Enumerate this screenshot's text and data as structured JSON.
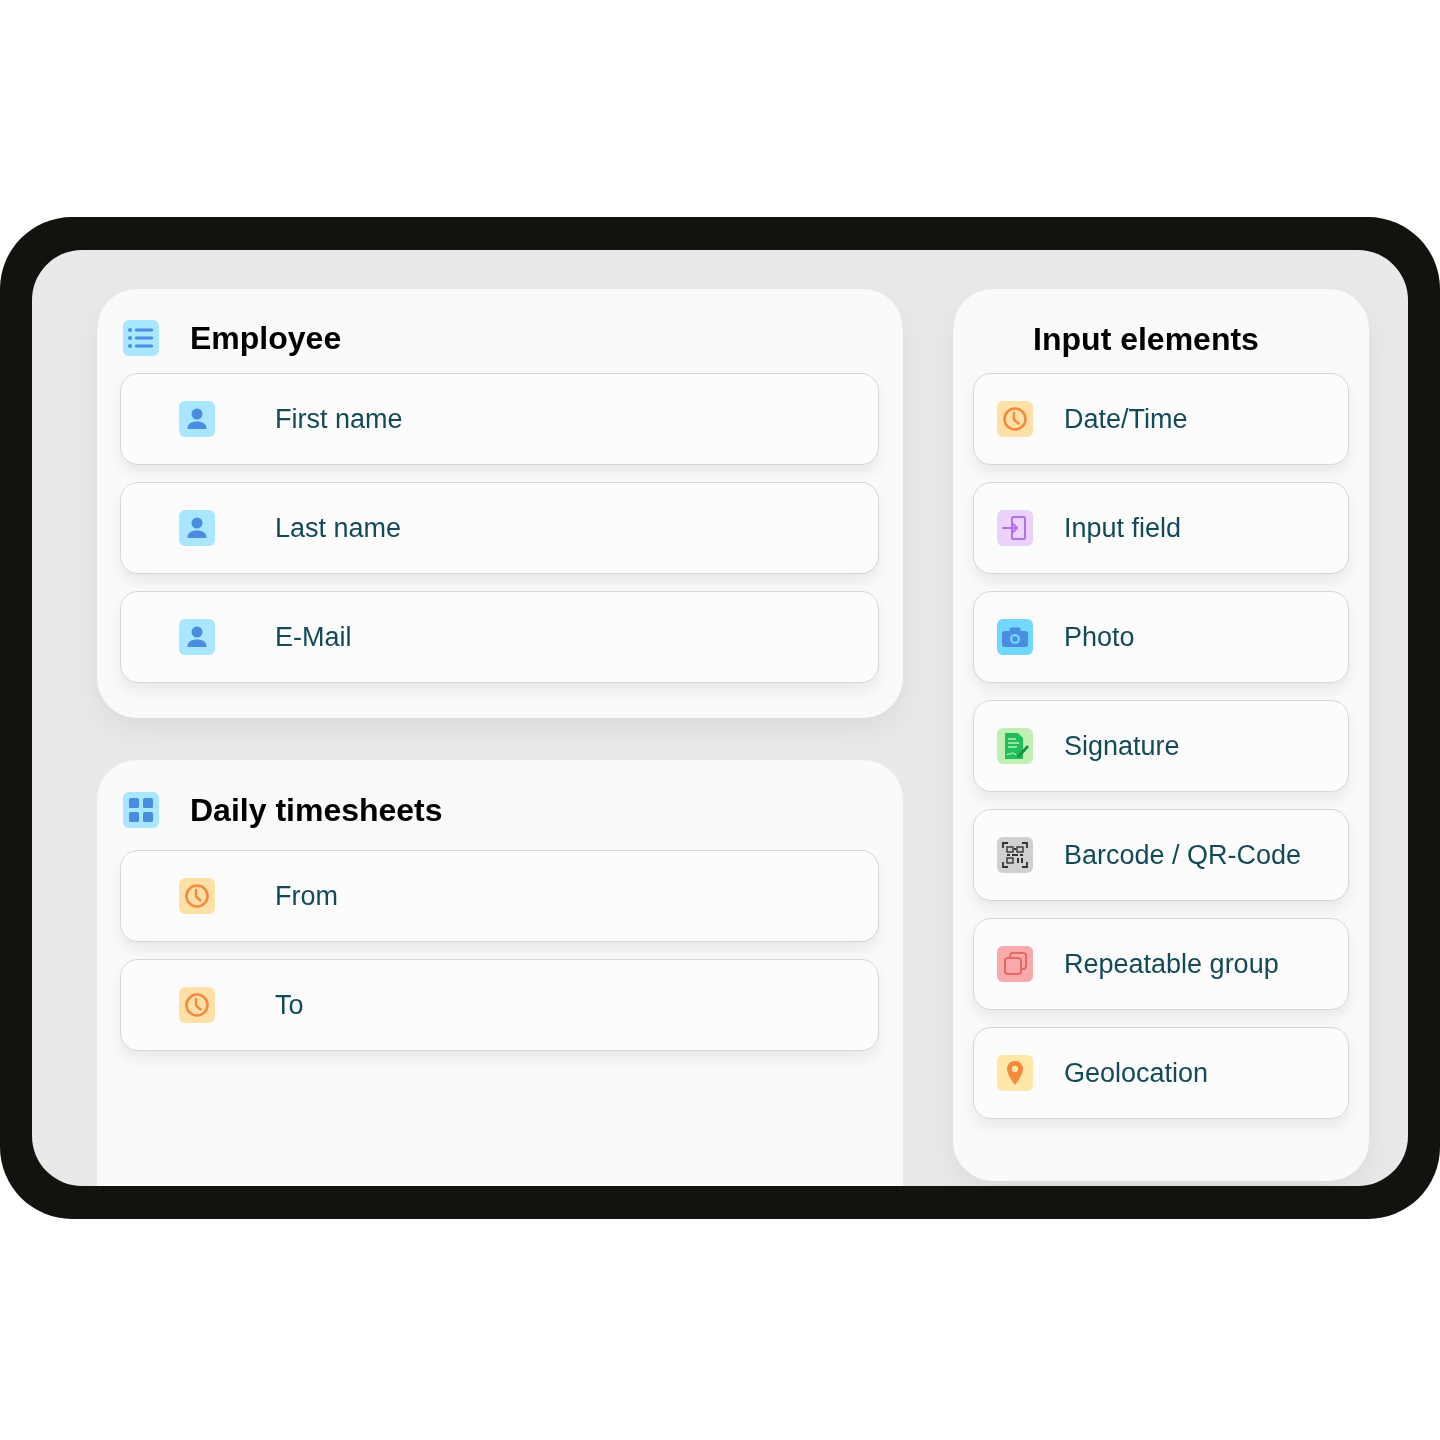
{
  "employee_panel": {
    "title": "Employee",
    "kind": "list",
    "fields": [
      {
        "label": "First name",
        "kind": "person"
      },
      {
        "label": "Last name",
        "kind": "person"
      },
      {
        "label": "E-Mail",
        "kind": "person"
      }
    ]
  },
  "timesheets_panel": {
    "title": "Daily timesheets",
    "kind": "grid",
    "fields": [
      {
        "label": "From",
        "kind": "clock"
      },
      {
        "label": "To",
        "kind": "clock"
      }
    ]
  },
  "input_elements": {
    "title": "Input elements",
    "items": [
      {
        "label": "Date/Time",
        "kind": "clock"
      },
      {
        "label": "Input field",
        "kind": "input"
      },
      {
        "label": "Photo",
        "kind": "camera"
      },
      {
        "label": "Signature",
        "kind": "signature"
      },
      {
        "label": "Barcode / QR-Code",
        "kind": "qr"
      },
      {
        "label": "Repeatable group",
        "kind": "repeat"
      },
      {
        "label": "Geolocation",
        "kind": "pin"
      }
    ]
  }
}
